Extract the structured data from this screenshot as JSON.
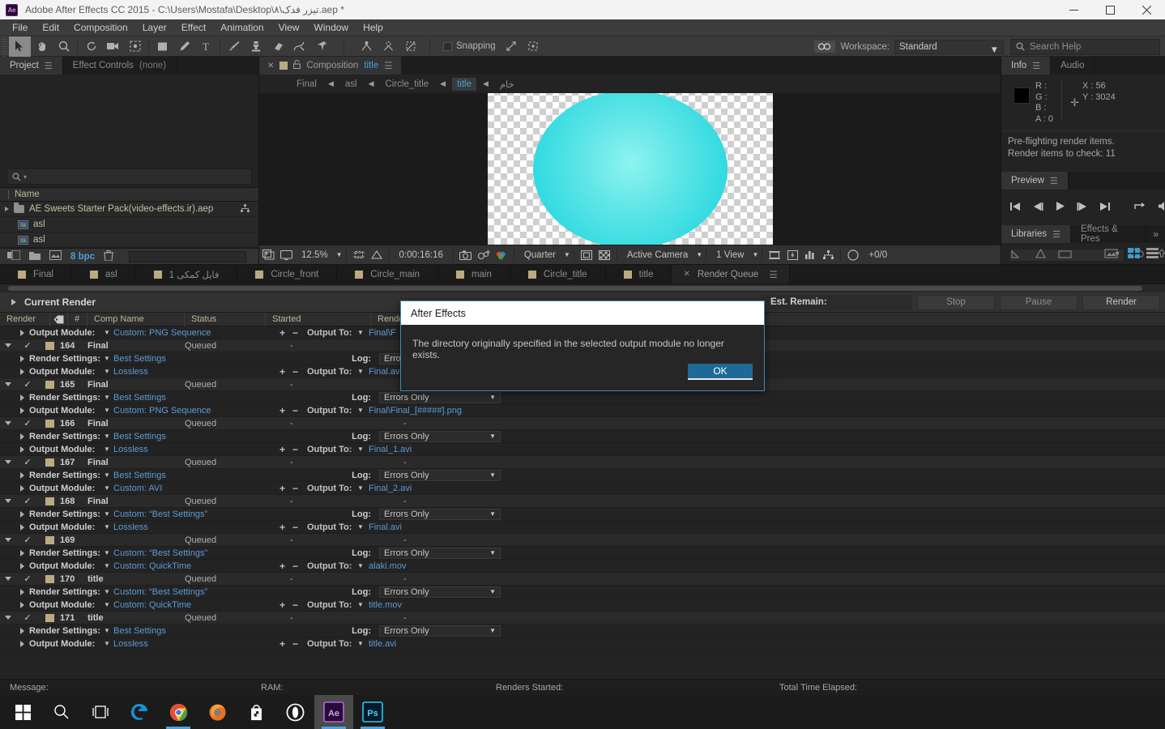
{
  "titlebar": {
    "app_icon": "ae-logo",
    "title": "Adobe After Effects CC 2015 - C:\\Users\\Mostafa\\Desktop\\۸\\تیزر فدک.aep *",
    "minimize": "minimize-icon",
    "maximize": "maximize-icon",
    "close": "close-icon"
  },
  "menubar": {
    "items": [
      "File",
      "Edit",
      "Composition",
      "Layer",
      "Effect",
      "Animation",
      "View",
      "Window",
      "Help"
    ]
  },
  "toolbar": {
    "snapping_label": "Snapping",
    "workspace_label": "Workspace:",
    "workspace_value": "Standard",
    "search_help_placeholder": "Search Help",
    "tools": [
      "selection-tool",
      "hand-tool",
      "zoom-tool",
      "rotation-tool",
      "camera-tool",
      "pan-behind-tool",
      "shape-tool",
      "pen-tool",
      "text-tool",
      "brush-tool",
      "clone-stamp-tool",
      "eraser-tool",
      "roto-brush-tool",
      "puppet-pin-tool"
    ]
  },
  "project_panel": {
    "tabs": [
      {
        "label": "Project",
        "active": true,
        "suffix": ""
      },
      {
        "label": "Effect Controls",
        "active": false,
        "suffix": "(none)"
      }
    ],
    "search_placeholder": "",
    "column_header": "Name",
    "rows": [
      {
        "name": "AE Sweets Starter Pack(video-effects.ir).aep",
        "type": "folder"
      },
      {
        "name": "asl",
        "type": "footage"
      },
      {
        "name": "asl",
        "type": "footage"
      }
    ],
    "bit_depth": "8 bpc"
  },
  "comp_panel": {
    "tab_label_prefix": "Composition",
    "tab_label_name": "title",
    "breadcrumb": [
      "Final",
      "asl",
      "Circle_title",
      "title",
      "خام"
    ],
    "breadcrumb_selected": "title",
    "zoom": "12.5%",
    "timecode": "0:00:16:16",
    "resolution": "Quarter",
    "camera": "Active Camera",
    "views": "1 View",
    "frame_offset": "+0/0"
  },
  "info_panel": {
    "tabs": [
      {
        "label": "Info",
        "active": true
      },
      {
        "label": "Audio",
        "active": false
      }
    ],
    "r": "R :",
    "g": "G :",
    "b": "B :",
    "a": "A : 0",
    "x": "X : 56",
    "y": "Y : 3024",
    "message_line1": "Pre-flighting render items.",
    "message_line2": "Render items to check: 11"
  },
  "preview_panel": {
    "tabs": [
      {
        "label": "Preview",
        "active": true
      }
    ],
    "buttons": [
      "first-frame",
      "previous-frame",
      "play",
      "next-frame",
      "last-frame",
      "loop",
      "mute"
    ]
  },
  "libraries_panel": {
    "tabs": [
      {
        "label": "Libraries",
        "active": true
      },
      {
        "label": "Effects & Pres",
        "active": false
      }
    ],
    "overflow": "»"
  },
  "comp_tabs": [
    {
      "label": "Final",
      "active": false,
      "closable": false
    },
    {
      "label": "asl",
      "active": false,
      "closable": false
    },
    {
      "label": "فایل کمکی 1",
      "active": false,
      "closable": false
    },
    {
      "label": "Circle_front",
      "active": false,
      "closable": false
    },
    {
      "label": "Circle_main",
      "active": false,
      "closable": false
    },
    {
      "label": "main",
      "active": false,
      "closable": false
    },
    {
      "label": "Circle_title",
      "active": false,
      "closable": false
    },
    {
      "label": "title",
      "active": false,
      "closable": false
    },
    {
      "label": "Render Queue",
      "active": true,
      "closable": true
    }
  ],
  "render_queue": {
    "current_render_label": "Current Render",
    "est_remain_label": "Est. Remain:",
    "stop_label": "Stop",
    "pause_label": "Pause",
    "render_label": "Render",
    "columns": [
      "Render",
      "",
      "#",
      "Comp Name",
      "Status",
      "Started",
      "Render T"
    ],
    "rows": [
      {
        "kind": "output",
        "label": "Output Module:",
        "value": "Custom: PNG Sequence",
        "out_label": "Output To:",
        "out_value": "Final\\F"
      },
      {
        "kind": "comp",
        "num": "164",
        "comp": "Final",
        "status": "Queued",
        "started": "-",
        "render_time": "-"
      },
      {
        "kind": "settings",
        "label": "Render Settings:",
        "value": "Best Settings",
        "log_label": "Log:",
        "log_value": "Errors Only"
      },
      {
        "kind": "output",
        "label": "Output Module:",
        "value": "Lossless",
        "out_label": "Output To:",
        "out_value": "Final.avi"
      },
      {
        "kind": "comp",
        "num": "165",
        "comp": "Final",
        "status": "Queued",
        "started": "-",
        "render_time": "-"
      },
      {
        "kind": "settings",
        "label": "Render Settings:",
        "value": "Best Settings",
        "log_label": "Log:",
        "log_value": "Errors Only"
      },
      {
        "kind": "output",
        "label": "Output Module:",
        "value": "Custom: PNG Sequence",
        "out_label": "Output To:",
        "out_value": "Final\\Final_[#####].png"
      },
      {
        "kind": "comp",
        "num": "166",
        "comp": "Final",
        "status": "Queued",
        "started": "-",
        "render_time": "-"
      },
      {
        "kind": "settings",
        "label": "Render Settings:",
        "value": "Best Settings",
        "log_label": "Log:",
        "log_value": "Errors Only"
      },
      {
        "kind": "output",
        "label": "Output Module:",
        "value": "Lossless",
        "out_label": "Output To:",
        "out_value": "Final_1.avi"
      },
      {
        "kind": "comp",
        "num": "167",
        "comp": "Final",
        "status": "Queued",
        "started": "-",
        "render_time": "-"
      },
      {
        "kind": "settings",
        "label": "Render Settings:",
        "value": "Best Settings",
        "log_label": "Log:",
        "log_value": "Errors Only"
      },
      {
        "kind": "output",
        "label": "Output Module:",
        "value": "Custom: AVI",
        "out_label": "Output To:",
        "out_value": "Final_2.avi"
      },
      {
        "kind": "comp",
        "num": "168",
        "comp": "Final",
        "status": "Queued",
        "started": "-",
        "render_time": "-"
      },
      {
        "kind": "settings",
        "label": "Render Settings:",
        "value": "Custom: “Best Settings”",
        "log_label": "Log:",
        "log_value": "Errors Only"
      },
      {
        "kind": "output",
        "label": "Output Module:",
        "value": "Lossless",
        "out_label": "Output To:",
        "out_value": "Final.avi"
      },
      {
        "kind": "comp",
        "num": "169",
        "comp": "",
        "status": "Queued",
        "started": "-",
        "render_time": "-"
      },
      {
        "kind": "settings",
        "label": "Render Settings:",
        "value": "Custom: “Best Settings”",
        "log_label": "Log:",
        "log_value": "Errors Only"
      },
      {
        "kind": "output",
        "label": "Output Module:",
        "value": "Custom: QuickTime",
        "out_label": "Output To:",
        "out_value": "alaki.mov"
      },
      {
        "kind": "comp",
        "num": "170",
        "comp": "title",
        "status": "Queued",
        "started": "-",
        "render_time": "-"
      },
      {
        "kind": "settings",
        "label": "Render Settings:",
        "value": "Custom: “Best Settings”",
        "log_label": "Log:",
        "log_value": "Errors Only"
      },
      {
        "kind": "output",
        "label": "Output Module:",
        "value": "Custom: QuickTime",
        "out_label": "Output To:",
        "out_value": "title.mov"
      },
      {
        "kind": "comp",
        "num": "171",
        "comp": "title",
        "status": "Queued",
        "started": "-",
        "render_time": "-"
      },
      {
        "kind": "settings",
        "label": "Render Settings:",
        "value": "Best Settings",
        "log_label": "Log:",
        "log_value": "Errors Only"
      },
      {
        "kind": "output",
        "label": "Output Module:",
        "value": "Lossless",
        "out_label": "Output To:",
        "out_value": "title.avi"
      }
    ]
  },
  "status_bar": {
    "message": "Message:",
    "ram": "RAM:",
    "renders_started": "Renders Started:",
    "total_time_elapsed": "Total Time Elapsed:"
  },
  "taskbar": {
    "items": [
      "start-icon",
      "search-icon",
      "task-view-icon",
      "edge-icon",
      "chrome-icon",
      "firefox-icon",
      "store-icon",
      "opera-icon",
      "after-effects-icon",
      "photoshop-icon"
    ]
  },
  "modal": {
    "title": "After Effects",
    "message": "The directory originally specified in the selected output module no longer exists.",
    "ok_label": "OK"
  },
  "colors": {
    "accent_blue": "#5b9bd5",
    "ok_button": "#1e6a96",
    "label_tan": "#bda983",
    "circle_cyan": "#4fe0e4"
  }
}
